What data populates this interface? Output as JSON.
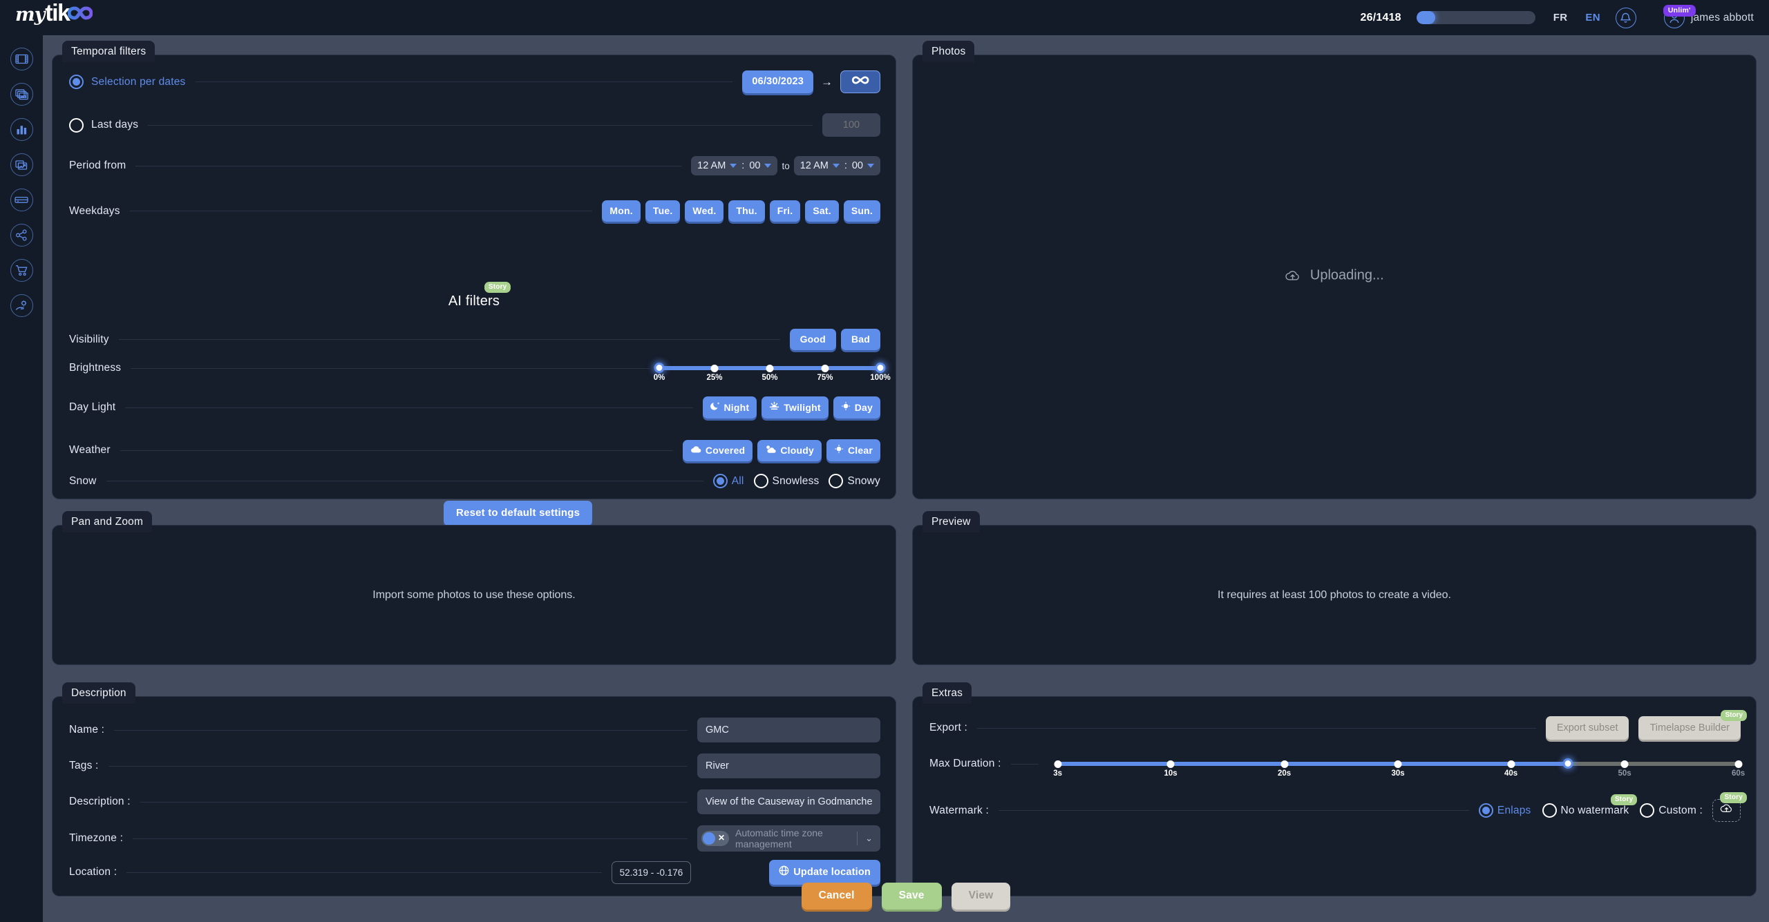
{
  "header": {
    "logo": {
      "part1": "my",
      "part2": "tik",
      "icon": "infinity-icon"
    },
    "quota": "26/1418",
    "quota_fill_percent": 16,
    "lang_fr": "FR",
    "lang_en": "EN",
    "bell_icon": "notification-bell-icon",
    "avatar_icon": "user-avatar-icon",
    "plan_badge": "Unlim'",
    "user_name": "james abbott",
    "accent": "#5f8dea"
  },
  "sidebar": {
    "items": [
      {
        "name": "sidebar-item-timelapse",
        "icon": "film-strip-icon"
      },
      {
        "name": "sidebar-item-albums",
        "icon": "stacked-photos-icon"
      },
      {
        "name": "sidebar-item-statistics",
        "icon": "bar-chart-icon"
      },
      {
        "name": "sidebar-item-reports",
        "icon": "photo-chart-icon"
      },
      {
        "name": "sidebar-item-devices",
        "icon": "camera-device-icon"
      },
      {
        "name": "sidebar-item-share",
        "icon": "share-nodes-icon"
      },
      {
        "name": "sidebar-item-store",
        "icon": "shopping-cart-icon"
      },
      {
        "name": "sidebar-item-services",
        "icon": "hand-gear-icon"
      }
    ]
  },
  "temporal_filters": {
    "tab": "Temporal filters",
    "selection_per_dates": {
      "label": "Selection per dates",
      "checked": true
    },
    "date_start": "06/30/2023",
    "arrow": "→",
    "date_end_icon": "infinity-icon",
    "last_days": {
      "label": "Last days",
      "checked": false,
      "value": "100"
    },
    "period_from": {
      "label": "Period from",
      "start_hour": "12 AM",
      "start_min": "00",
      "to": "to",
      "end_hour": "12 AM",
      "end_min": "00",
      "colon": ":"
    },
    "weekdays": {
      "label": "Weekdays",
      "days": [
        "Mon.",
        "Tue.",
        "Wed.",
        "Thu.",
        "Fri.",
        "Sat.",
        "Sun."
      ]
    },
    "ai_filters": {
      "title": "AI filters",
      "badge": "Story",
      "visibility": {
        "label": "Visibility",
        "options": [
          "Good",
          "Bad"
        ]
      },
      "brightness": {
        "label": "Brightness",
        "ticks": [
          "0%",
          "25%",
          "50%",
          "75%",
          "100%"
        ],
        "range_start": 0,
        "range_end": 100
      },
      "day_light": {
        "label": "Day Light",
        "options": [
          {
            "label": "Night",
            "icon": "moon-icon"
          },
          {
            "label": "Twilight",
            "icon": "sunset-icon"
          },
          {
            "label": "Day",
            "icon": "sun-icon"
          }
        ]
      },
      "weather": {
        "label": "Weather",
        "options": [
          {
            "label": "Covered",
            "icon": "cloud-icon"
          },
          {
            "label": "Cloudy",
            "icon": "sun-cloud-icon"
          },
          {
            "label": "Clear",
            "icon": "sun-icon"
          }
        ]
      },
      "snow": {
        "label": "Snow",
        "options": [
          {
            "label": "All",
            "checked": true
          },
          {
            "label": "Snowless",
            "checked": false
          },
          {
            "label": "Snowy",
            "checked": false
          }
        ]
      }
    },
    "reset_button": "Reset to default settings"
  },
  "photos": {
    "tab": "Photos",
    "status": "Uploading...",
    "status_icon": "cloud-upload-icon"
  },
  "pan_and_zoom": {
    "tab": "Pan and Zoom",
    "message": "Import some photos to use these options."
  },
  "preview": {
    "tab": "Preview",
    "message": "It requires at least 100 photos to create a video."
  },
  "description": {
    "tab": "Description",
    "fields": [
      {
        "label": "Name :",
        "value": "GMC"
      },
      {
        "label": "Tags :",
        "value": "River"
      },
      {
        "label": "Description :",
        "value": "View of the Causeway in Godmanchester"
      }
    ],
    "timezone": {
      "label": "Timezone :",
      "toggle_on": true,
      "placeholder": "Automatic time zone management",
      "caret": "⌄"
    },
    "location": {
      "label": "Location :",
      "coords": "52.319 - -0.176",
      "update_button": "Update location",
      "update_icon": "globe-icon"
    }
  },
  "extras": {
    "tab": "Extras",
    "export": {
      "label": "Export :",
      "export_subset": "Export subset",
      "timelapse_builder": "Timelapse Builder",
      "timelapse_badge": "Story"
    },
    "max_duration": {
      "label": "Max Duration :",
      "ticks": [
        "3s",
        "10s",
        "20s",
        "30s",
        "40s",
        "50s",
        "60s"
      ],
      "value": "45s",
      "filled_fraction": 0.75
    },
    "watermark": {
      "label": "Watermark :",
      "options": [
        {
          "label": "Enlaps",
          "checked": true,
          "badge": null
        },
        {
          "label": "No watermark",
          "checked": false,
          "badge": "Story"
        },
        {
          "label": "Custom :",
          "checked": false,
          "badge": null
        }
      ],
      "upload_icon": "cloud-upload-icon",
      "upload_badge": "Story"
    }
  },
  "actions": {
    "cancel": "Cancel",
    "save": "Save",
    "view": "View"
  }
}
